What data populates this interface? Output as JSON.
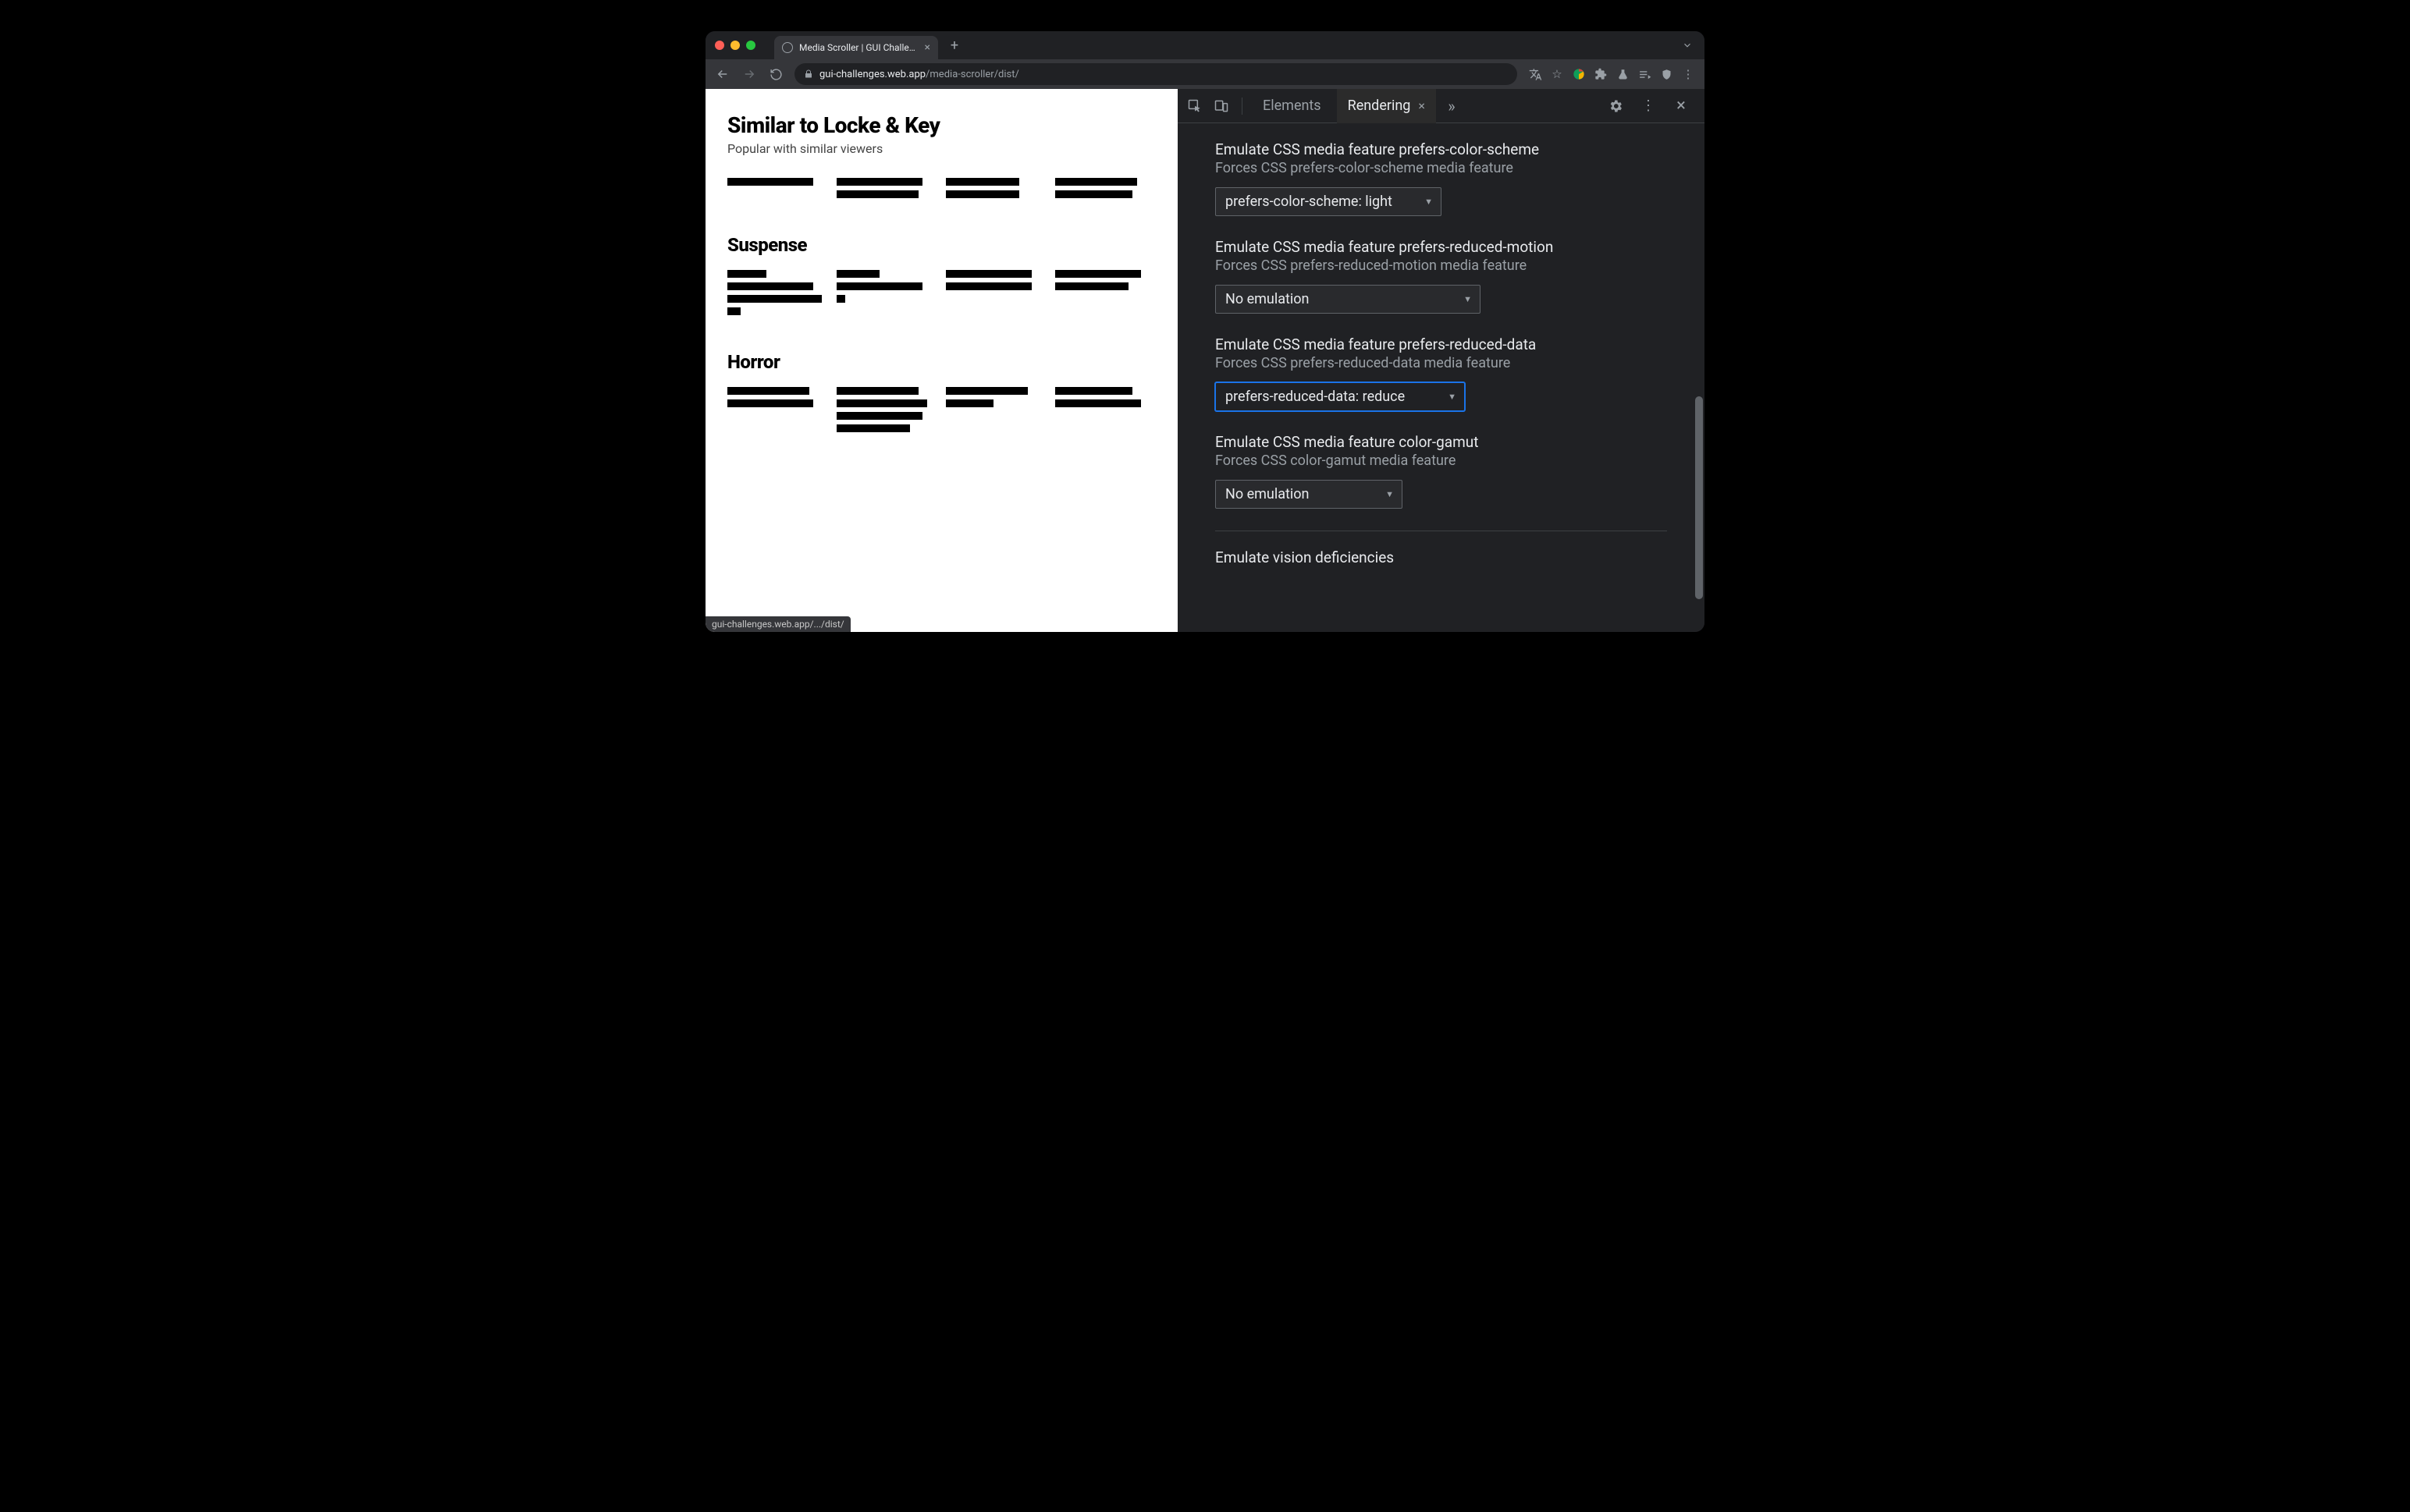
{
  "browser": {
    "tab_title": "Media Scroller | GUI Challenges",
    "url_domain": "gui-challenges.web.app",
    "url_path": "/media-scroller/dist/",
    "status_text": "gui-challenges.web.app/.../dist/"
  },
  "page": {
    "sections": [
      {
        "title": "Similar to Locke & Key",
        "subtitle": "Popular with similar viewers"
      },
      {
        "title": "Suspense"
      },
      {
        "title": "Horror"
      }
    ]
  },
  "devtools": {
    "tabs": {
      "elements": "Elements",
      "rendering": "Rendering"
    },
    "settings": [
      {
        "title": "Emulate CSS media feature prefers-color-scheme",
        "desc": "Forces CSS prefers-color-scheme media feature",
        "value": "prefers-color-scheme: light",
        "focused": false,
        "width": "narrow"
      },
      {
        "title": "Emulate CSS media feature prefers-reduced-motion",
        "desc": "Forces CSS prefers-reduced-motion media feature",
        "value": "No emulation",
        "focused": false,
        "width": "wide"
      },
      {
        "title": "Emulate CSS media feature prefers-reduced-data",
        "desc": "Forces CSS prefers-reduced-data media feature",
        "value": "prefers-reduced-data: reduce",
        "focused": true,
        "width": "wide"
      },
      {
        "title": "Emulate CSS media feature color-gamut",
        "desc": "Forces CSS color-gamut media feature",
        "value": "No emulation",
        "focused": false,
        "width": ""
      }
    ],
    "vision_title": "Emulate vision deficiencies"
  }
}
